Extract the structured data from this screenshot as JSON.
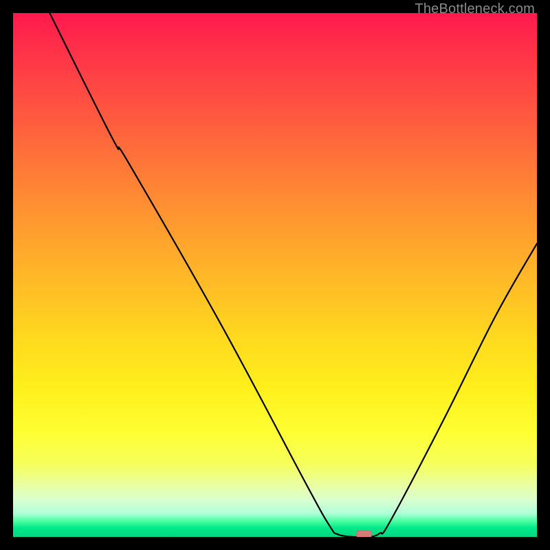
{
  "watermark": "TheBottleneck.com",
  "chart_data": {
    "type": "line",
    "title": "",
    "xlabel": "",
    "ylabel": "",
    "xlim": [
      0,
      100
    ],
    "ylim": [
      0,
      100
    ],
    "grid": false,
    "background": "red-yellow-green vertical gradient",
    "series": [
      {
        "name": "bottleneck-curve",
        "points": [
          {
            "x": 7.0,
            "y": 100.0
          },
          {
            "x": 19.0,
            "y": 76.0
          },
          {
            "x": 22.0,
            "y": 71.5
          },
          {
            "x": 40.0,
            "y": 40.0
          },
          {
            "x": 56.0,
            "y": 10.0
          },
          {
            "x": 60.5,
            "y": 2.0
          },
          {
            "x": 62.0,
            "y": 0.5
          },
          {
            "x": 65.0,
            "y": 0.0
          },
          {
            "x": 68.0,
            "y": 0.0
          },
          {
            "x": 70.0,
            "y": 0.7
          },
          {
            "x": 72.0,
            "y": 3.0
          },
          {
            "x": 82.0,
            "y": 22.0
          },
          {
            "x": 92.0,
            "y": 42.0
          },
          {
            "x": 100.0,
            "y": 56.0
          }
        ]
      }
    ],
    "marker": {
      "x": 67.0,
      "y": 0.5,
      "shape": "rounded-rect",
      "color": "#d97a7a"
    }
  }
}
